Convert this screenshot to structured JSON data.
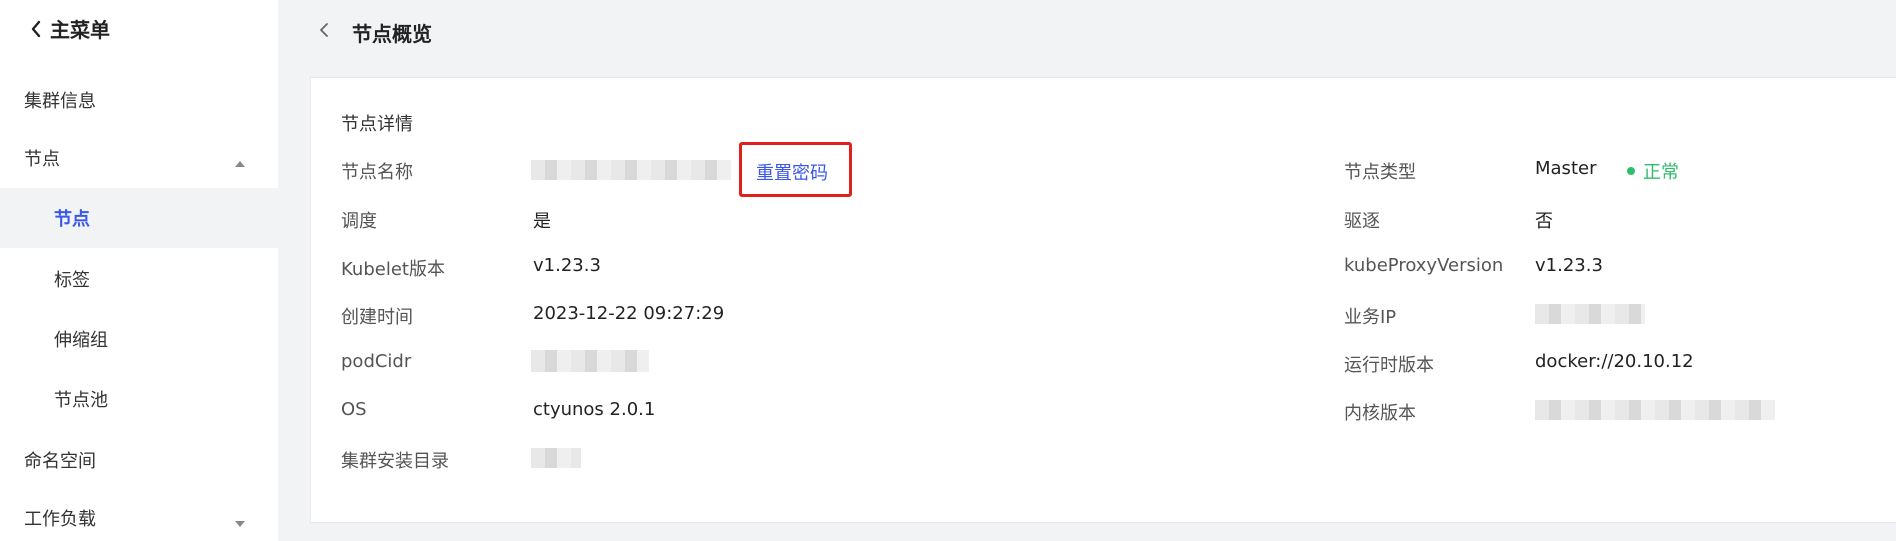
{
  "sidebar": {
    "main_menu_label": "主菜单",
    "items": [
      {
        "label": "集群信息"
      },
      {
        "label": "节点"
      },
      {
        "label": "节点"
      },
      {
        "label": "标签"
      },
      {
        "label": "伸缩组"
      },
      {
        "label": "节点池"
      },
      {
        "label": "命名空间"
      },
      {
        "label": "工作负载"
      }
    ],
    "active_color": "#3a57e8"
  },
  "header": {
    "title": "节点概览"
  },
  "details": {
    "section_title": "节点详情",
    "reset_password_label": "重置密码",
    "left": [
      {
        "label": "节点名称",
        "value": ""
      },
      {
        "label": "调度",
        "value": "是"
      },
      {
        "label": "Kubelet版本",
        "value": "v1.23.3"
      },
      {
        "label": "创建时间",
        "value": "2023-12-22 09:27:29"
      },
      {
        "label": "podCidr",
        "value": ""
      },
      {
        "label": "OS",
        "value": "ctyunos 2.0.1"
      },
      {
        "label": "集群安装目录",
        "value": ""
      }
    ],
    "right": [
      {
        "label": "节点类型",
        "value": "Master"
      },
      {
        "label": "驱逐",
        "value": "否"
      },
      {
        "label": "kubeProxyVersion",
        "value": "v1.23.3"
      },
      {
        "label": "业务IP",
        "value": ""
      },
      {
        "label": "运行时版本",
        "value": "docker://20.10.12"
      },
      {
        "label": "内核版本",
        "value": ""
      }
    ],
    "status_text": "正常",
    "status_color": "#2ebd6b",
    "highlight_color": "#e0201c"
  }
}
